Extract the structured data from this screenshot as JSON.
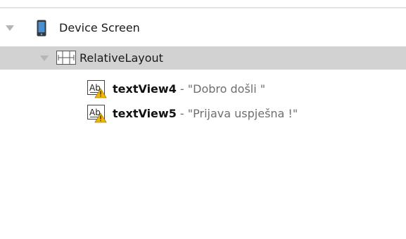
{
  "tree": {
    "device": {
      "label": "Device Screen",
      "icon": "phone-icon",
      "expanded": true
    },
    "layout": {
      "label": "RelativeLayout",
      "icon": "relativelayout-icon",
      "expanded": true,
      "selected": true
    },
    "items": [
      {
        "id": "textView4",
        "separator": " - ",
        "value": "\"Dobro došli \"",
        "icon": "textview-warning-icon"
      },
      {
        "id": "textView5",
        "separator": " - ",
        "value": "\"Prijava uspješna !\"",
        "icon": "textview-warning-icon"
      }
    ]
  },
  "colors": {
    "selection": "#d2d2d2",
    "expander": "#b5b5b5",
    "phone_blue": "#4a8fd4",
    "warning": "#f2b705"
  }
}
